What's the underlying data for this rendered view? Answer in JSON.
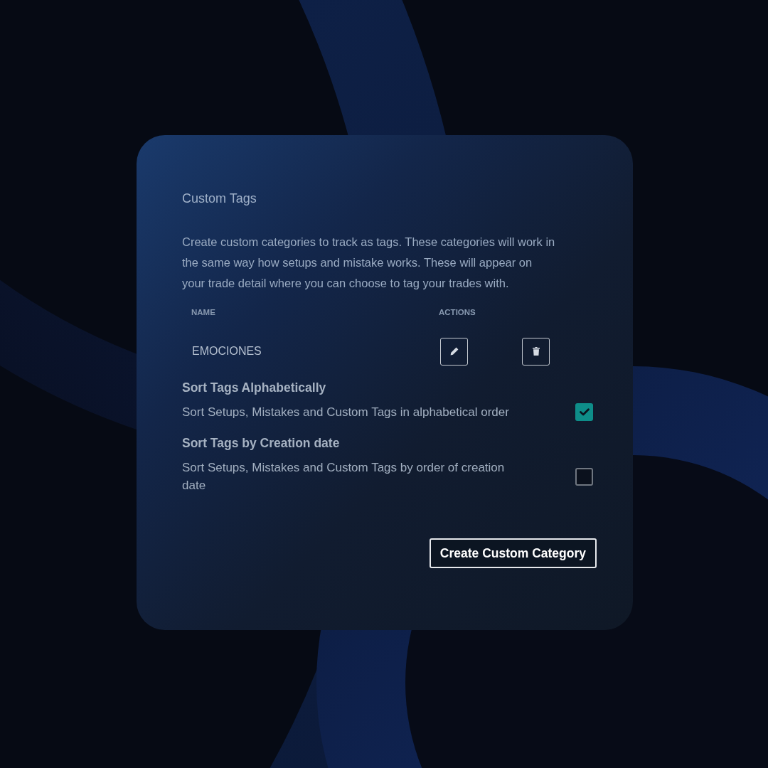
{
  "card": {
    "title": "Custom Tags",
    "description": "Create custom categories to track as tags. These categories will work in the same way how setups and mistake works. These will appear on your trade detail where you can choose to tag your trades with."
  },
  "table": {
    "columns": [
      "NAME",
      "ACTIONS"
    ],
    "rows": [
      {
        "name": "EMOCIONES"
      }
    ]
  },
  "sort_options": [
    {
      "title": "Sort Tags Alphabetically",
      "description": "Sort Setups, Mistakes and Custom Tags in alphabetical order",
      "checked": true
    },
    {
      "title": "Sort Tags by Creation date",
      "description": "Sort Setups, Mistakes and Custom Tags by order of creation date",
      "checked": false
    }
  ],
  "create_button": "Create Custom Category"
}
